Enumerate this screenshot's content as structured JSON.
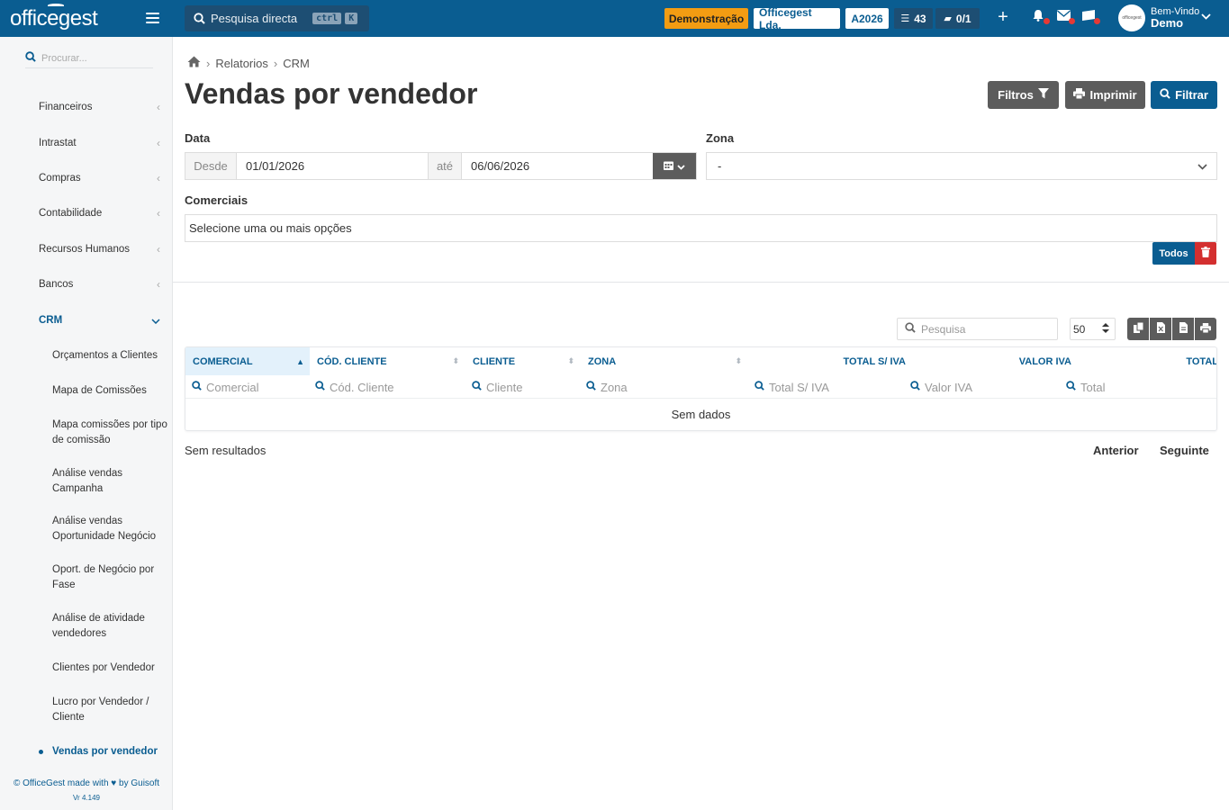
{
  "topbar": {
    "logo": "officegest",
    "search_placeholder": "Pesquisa directa",
    "shortcut_key1": "ctrl",
    "shortcut_key2": "K",
    "badge_demo": "Demonstração",
    "badge_company": "Officegest Lda.",
    "badge_year": "A2026",
    "tasks_count": "43",
    "docs_count": "0/1",
    "welcome": "Bem-Vindo",
    "user_name": "Demo",
    "colors": {
      "bar": "#0a5d91",
      "demo": "#f39c12"
    }
  },
  "sidebar": {
    "search_placeholder": "Procurar...",
    "items": [
      {
        "label": "Financeiros"
      },
      {
        "label": "Intrastat"
      },
      {
        "label": "Compras"
      },
      {
        "label": "Contabilidade"
      },
      {
        "label": "Recursos Humanos"
      },
      {
        "label": "Bancos"
      },
      {
        "label": "CRM"
      }
    ],
    "crm_items": [
      "Orçamentos a Clientes",
      "Mapa de Comissões",
      "Mapa comissões por tipo de comissão",
      "Análise vendas Campanha",
      "Análise vendas Oportunidade Negócio",
      "Oport. de Negócio por Fase",
      "Análise de atividade vendedores",
      "Clientes por Vendedor",
      "Lucro por Vendedor / Cliente",
      "Vendas por vendedor"
    ],
    "footer_prefix": "© OfficeGest made with",
    "footer_suffix": "by Guisoft",
    "version": "Vr 4.149"
  },
  "breadcrumb": {
    "level1": "Relatorios",
    "level2": "CRM"
  },
  "page": {
    "title": "Vendas por vendedor",
    "btn_filtros": "Filtros",
    "btn_imprimir": "Imprimir",
    "btn_filtrar": "Filtrar"
  },
  "filters": {
    "date_label": "Data",
    "from_label": "Desde",
    "from_value": "01/01/2026",
    "to_label": "até",
    "to_value": "06/06/2026",
    "zona_label": "Zona",
    "zona_value": "-",
    "comerciais_label": "Comerciais",
    "comerciais_placeholder": "Selecione uma ou mais opções",
    "btn_todos": "Todos"
  },
  "table": {
    "search_placeholder": "Pesquisa",
    "page_size": "50",
    "columns": [
      {
        "header": "Comercial",
        "filter": "Comercial"
      },
      {
        "header": "Cód. Cliente",
        "filter": "Cód. Cliente"
      },
      {
        "header": "Cliente",
        "filter": "Cliente"
      },
      {
        "header": "Zona",
        "filter": "Zona"
      },
      {
        "header": "Total S/ IVA",
        "filter": "Total S/ IVA"
      },
      {
        "header": "Valor IVA",
        "filter": "Valor IVA"
      },
      {
        "header": "Total",
        "filter": "Total"
      }
    ],
    "empty_text": "Sem dados",
    "results_text": "Sem resultados",
    "prev_label": "Anterior",
    "next_label": "Seguinte"
  }
}
